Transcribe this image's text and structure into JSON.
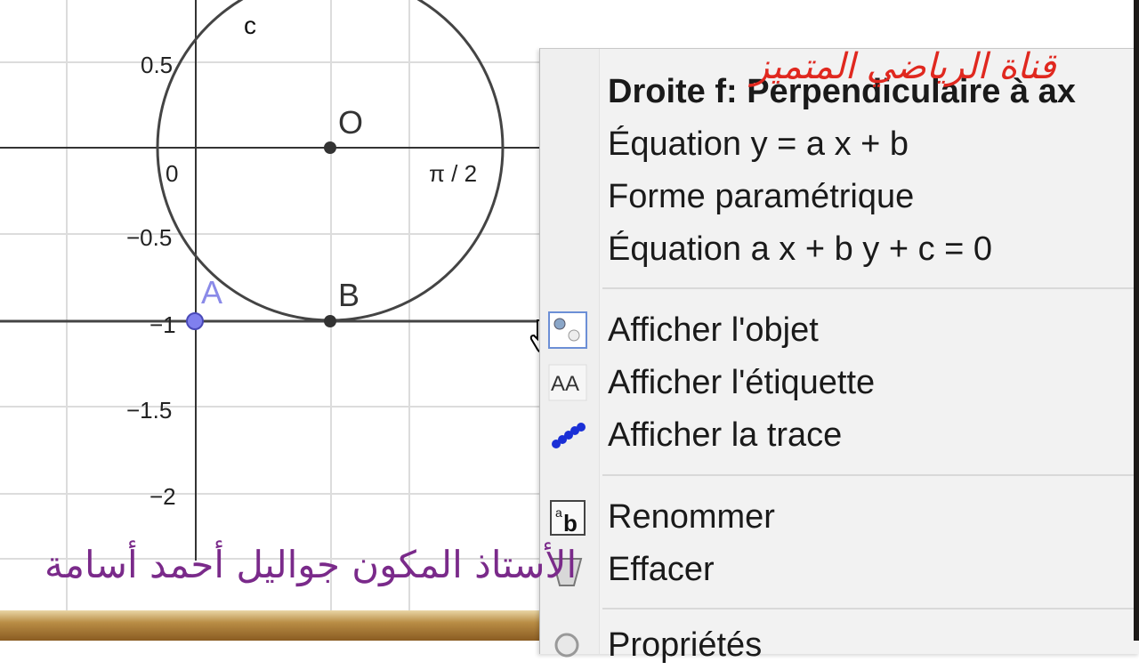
{
  "graphics": {
    "y_ticks": [
      "0.5",
      "−0.5",
      "−1",
      "−1.5",
      "−2"
    ],
    "origin_label": "0",
    "x_tick": "π / 2",
    "circle_label": "c",
    "points": {
      "A": "A",
      "B": "B",
      "O": "O"
    }
  },
  "context_menu": {
    "title": "Droite f: Perpendiculaire à ax",
    "items": [
      {
        "label": "Équation y = a x + b"
      },
      {
        "label": "Forme paramétrique"
      },
      {
        "label": "Équation a x + b y + c = 0"
      },
      {
        "label": "Afficher l'objet",
        "icon": "show-object-icon"
      },
      {
        "label": "Afficher l'étiquette",
        "icon": "show-label-icon"
      },
      {
        "label": "Afficher la trace",
        "icon": "trace-icon"
      },
      {
        "label": "Renommer",
        "icon": "rename-icon"
      },
      {
        "label": "Effacer",
        "icon": "delete-icon"
      },
      {
        "label": "Propriétés",
        "icon": "properties-icon"
      }
    ],
    "icon_text": {
      "label_icon": "AA",
      "rename_a": "a",
      "rename_b": "b"
    }
  },
  "watermarks": {
    "top": "قناة الرياضي المتميز",
    "bottom": "الأستاذ المكون جواليل أحمد أسامة"
  },
  "colors": {
    "point_a": "#6a6ae0",
    "watermark_top": "#e0281f",
    "watermark_bottom": "#7a2a8a"
  }
}
